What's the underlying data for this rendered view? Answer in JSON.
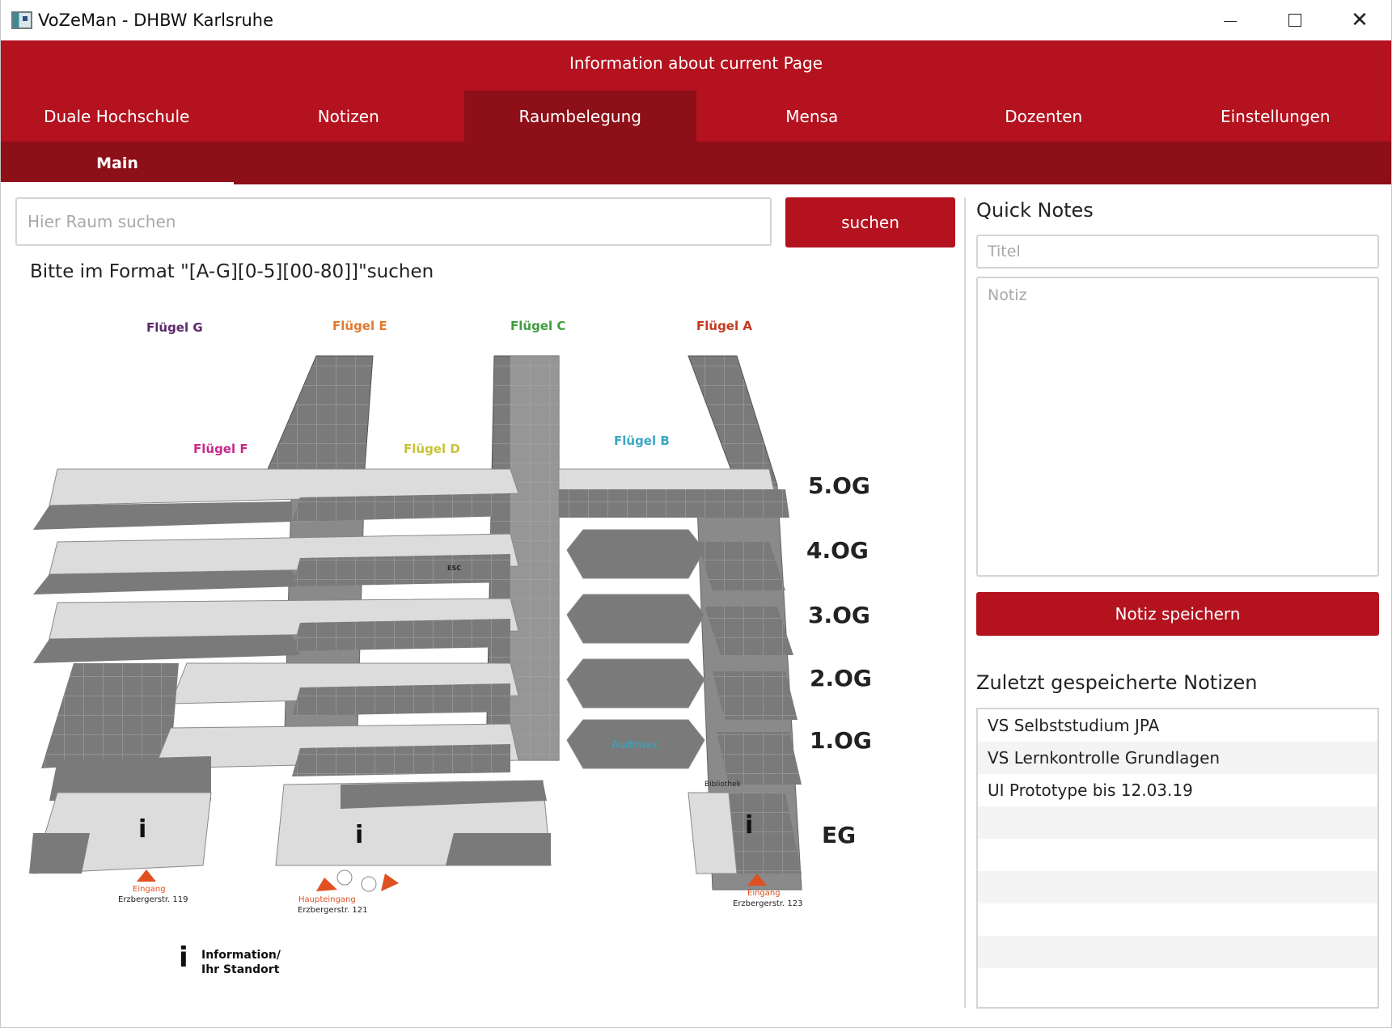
{
  "window": {
    "title": "VoZeMan - DHBW Karlsruhe",
    "minimize_label": "—",
    "maximize_label": "☐",
    "close_label": "✕"
  },
  "header": {
    "info_text": "Information about current Page",
    "tabs": [
      {
        "label": "Duale Hochschule"
      },
      {
        "label": "Notizen"
      },
      {
        "label": "Raumbelegung"
      },
      {
        "label": "Mensa"
      },
      {
        "label": "Dozenten"
      },
      {
        "label": "Einstellungen"
      }
    ],
    "active_tab": "Raumbelegung",
    "subtab": "Main"
  },
  "search": {
    "placeholder": "Hier Raum suchen",
    "value": "",
    "button_label": "suchen",
    "format_hint": "Bitte im Format \"[A-G][0-5][00-80]]\"suchen"
  },
  "map": {
    "wings": [
      "Flügel G",
      "Flügel E",
      "Flügel C",
      "Flügel A",
      "Flügel F",
      "Flügel D",
      "Flügel B"
    ],
    "floors": [
      "5.OG",
      "4.OG",
      "3.OG",
      "2.OG",
      "1.OG",
      "EG"
    ],
    "entrances": [
      {
        "label": "Eingang",
        "address": "Erzbergerstr. 119"
      },
      {
        "label": "Haupteingang",
        "address": "Erzbergerstr. 121"
      },
      {
        "label": "Eingang",
        "address": "Erzbergerstr. 123"
      }
    ],
    "audimax_label": "Audimax",
    "library_label": "Bibliothek",
    "esc_label": "ESC",
    "legend_line1": "Information/",
    "legend_line2": "Ihr Standort",
    "colors": {
      "wing_g": "#5b2a6e",
      "wing_e": "#e07a2e",
      "wing_c": "#3f9d3f",
      "wing_a": "#c43a1e",
      "wing_f": "#c72a8a",
      "wing_d": "#c8c23a",
      "wing_b": "#3aa7c2"
    }
  },
  "quick_notes": {
    "title": "Quick Notes",
    "title_placeholder": "Titel",
    "note_placeholder": "Notiz",
    "save_label": "Notiz speichern",
    "recent_title": "Zuletzt gespeicherte Notizen",
    "recent": [
      {
        "label": "VS Selbststudium JPA"
      },
      {
        "label": "VS Lernkontrolle Grundlagen"
      },
      {
        "label": "UI Prototype bis 12.03.19"
      },
      {
        "label": ""
      },
      {
        "label": ""
      },
      {
        "label": ""
      },
      {
        "label": ""
      },
      {
        "label": ""
      },
      {
        "label": ""
      }
    ]
  },
  "colors": {
    "primary": "#b4121f",
    "primary_dark": "#8d0f18"
  }
}
